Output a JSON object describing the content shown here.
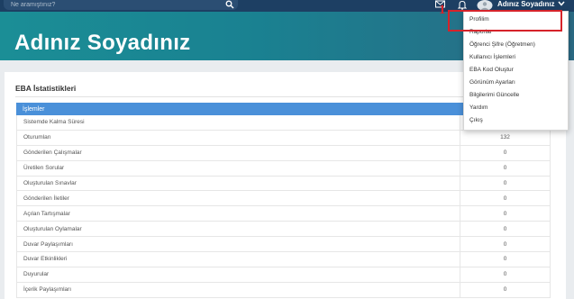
{
  "header": {
    "search_placeholder": "Ne aramıştınız?",
    "user_name": "Adınız Soyadınız",
    "annotation_number": "1"
  },
  "hero": {
    "title": "Adınız Soyadınız"
  },
  "stats": {
    "title": "EBA İstatistikleri",
    "column_header": "İşlemler",
    "rows": [
      {
        "label": "Sistemde Kalma Süresi",
        "value": ""
      },
      {
        "label": "Oturumları",
        "value": "132"
      },
      {
        "label": "Gönderilen Çalışmalar",
        "value": "0"
      },
      {
        "label": "Üretilen Sorular",
        "value": "0"
      },
      {
        "label": "Oluşturulan Sınavlar",
        "value": "0"
      },
      {
        "label": "Gönderilen İletiler",
        "value": "0"
      },
      {
        "label": "Açılan Tartışmalar",
        "value": "0"
      },
      {
        "label": "Oluşturulan Oylamalar",
        "value": "0"
      },
      {
        "label": "Duvar Paylaşımları",
        "value": "0"
      },
      {
        "label": "Duvar Etkinlikleri",
        "value": "0"
      },
      {
        "label": "Duyurular",
        "value": "0"
      },
      {
        "label": "İçerik Paylaşımları",
        "value": "0"
      }
    ]
  },
  "dropdown": {
    "items": [
      "Profilim",
      "Raporlar",
      "Öğrenci Şifre (Öğretmen)",
      "Kullanıcı İşlemleri",
      "EBA Kod Oluştur",
      "Görünüm Ayarları",
      "Bilgilerimi Güncelle",
      "Yardım",
      "Çıkış"
    ]
  },
  "colors": {
    "topbar": "#1d3f63",
    "hero_start": "#1b8e96",
    "hero_end": "#2a6a84",
    "table_header": "#4a90d9",
    "annotation": "#d6232a"
  },
  "icons": [
    "search-icon",
    "mail-icon",
    "bell-icon",
    "avatar-icon",
    "chevron-down-icon"
  ]
}
